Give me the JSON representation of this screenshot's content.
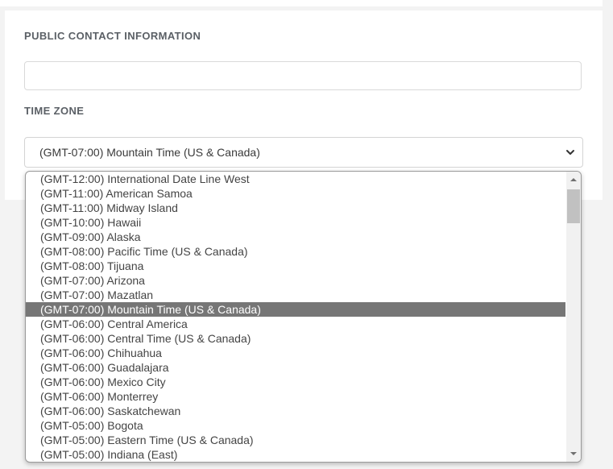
{
  "contact": {
    "label": "PUBLIC CONTACT INFORMATION",
    "value": ""
  },
  "timezone": {
    "label": "TIME ZONE",
    "selected": "(GMT-07:00) Mountain Time (US & Canada)",
    "options": [
      "(GMT-12:00) International Date Line West",
      "(GMT-11:00) American Samoa",
      "(GMT-11:00) Midway Island",
      "(GMT-10:00) Hawaii",
      "(GMT-09:00) Alaska",
      "(GMT-08:00) Pacific Time (US & Canada)",
      "(GMT-08:00) Tijuana",
      "(GMT-07:00) Arizona",
      "(GMT-07:00) Mazatlan",
      "(GMT-07:00) Mountain Time (US & Canada)",
      "(GMT-06:00) Central America",
      "(GMT-06:00) Central Time (US & Canada)",
      "(GMT-06:00) Chihuahua",
      "(GMT-06:00) Guadalajara",
      "(GMT-06:00) Mexico City",
      "(GMT-06:00) Monterrey",
      "(GMT-06:00) Saskatchewan",
      "(GMT-05:00) Bogota",
      "(GMT-05:00) Eastern Time (US & Canada)",
      "(GMT-05:00) Indiana (East)"
    ],
    "selected_index": 9
  },
  "icons": {
    "select_arrow": "chevron-down-icon",
    "scroll_up": "scroll-up-arrow-icon",
    "scroll_down": "scroll-down-arrow-icon"
  },
  "colors": {
    "selected_option_bg": "#767676",
    "label_text": "#5b6066"
  }
}
